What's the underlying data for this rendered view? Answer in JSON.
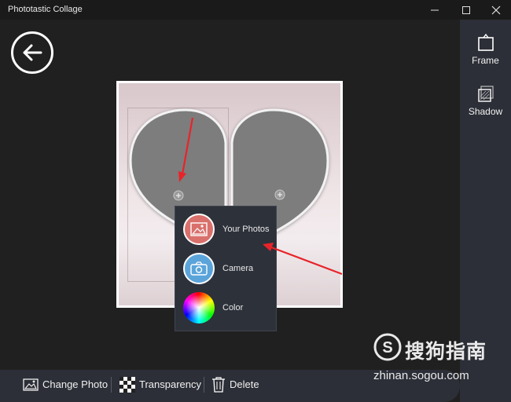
{
  "window": {
    "title": "Phototastic Collage"
  },
  "right_panel": {
    "frame_label": "Frame",
    "shadow_label": "Shadow"
  },
  "popup": {
    "items": [
      {
        "label": "Your Photos",
        "icon": "image-icon",
        "color": "#d9706b"
      },
      {
        "label": "Camera",
        "icon": "camera-icon",
        "color": "#5ba4da"
      },
      {
        "label": "Color",
        "icon": "color-wheel-icon"
      }
    ]
  },
  "toolbar": {
    "change_photo_label": "Change Photo",
    "transparency_label": "Transparency",
    "delete_label": "Delete"
  },
  "watermark": {
    "text": "搜狗指南",
    "url": "zhinan.sogou.com"
  },
  "colors": {
    "background": "#202020",
    "panel": "#2c2f37",
    "accent_red": "#e8242a"
  }
}
